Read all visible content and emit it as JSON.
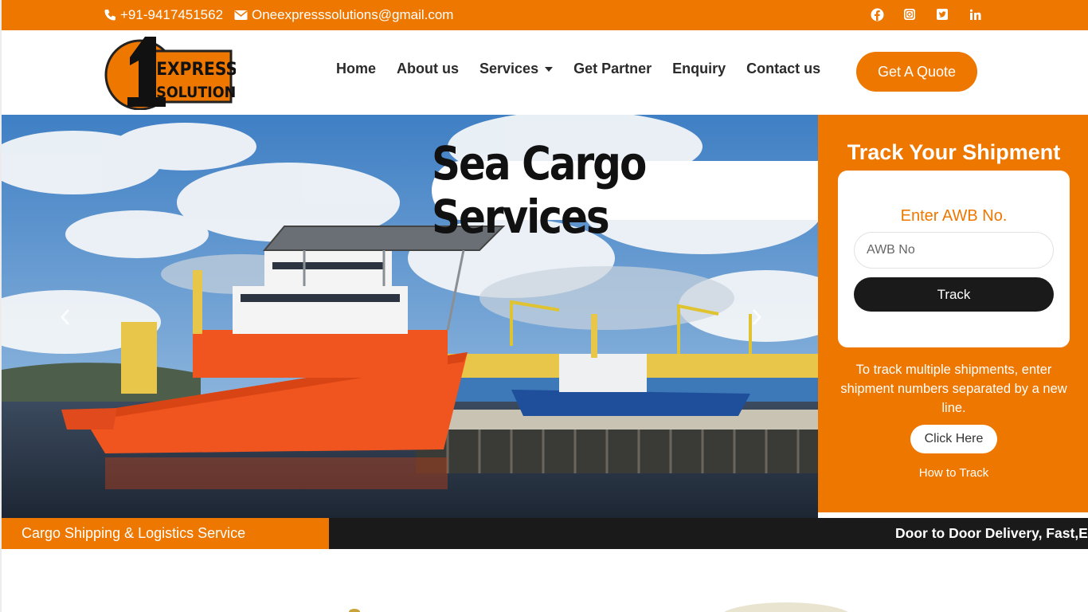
{
  "topbar": {
    "phone": "+91-9417451562",
    "email": "Oneexpresssolutions@gmail.com",
    "social": [
      "facebook-icon",
      "instagram-icon",
      "twitter-icon",
      "linkedin-icon"
    ]
  },
  "brand": {
    "logo_number": "1",
    "logo_line1": "EXPRESS",
    "logo_line2": "SOLUTIONS"
  },
  "nav": {
    "items": [
      "Home",
      "About us",
      "Services",
      "Get Partner",
      "Enquiry",
      "Contact us"
    ],
    "quote_label": "Get A Quote"
  },
  "hero": {
    "title": "Sea Cargo Services",
    "prev_icon": "chevron-left-icon",
    "next_icon": "chevron-right-icon"
  },
  "tracking": {
    "title": "Track Your Shipment",
    "awb_label": "Enter AWB No.",
    "awb_placeholder": "AWB No",
    "track_label": "Track",
    "multi_text": "To track multiple shipments, enter shipment numbers separated by a new line.",
    "click_here_label": "Click Here",
    "how_to_track": "How to Track"
  },
  "ticker": {
    "left_label": "Cargo Shipping & Logistics Service",
    "right_text": "Door to Door Delivery, Fast,E"
  },
  "colors": {
    "accent": "#ee7700",
    "dark": "#1a1a1a"
  }
}
